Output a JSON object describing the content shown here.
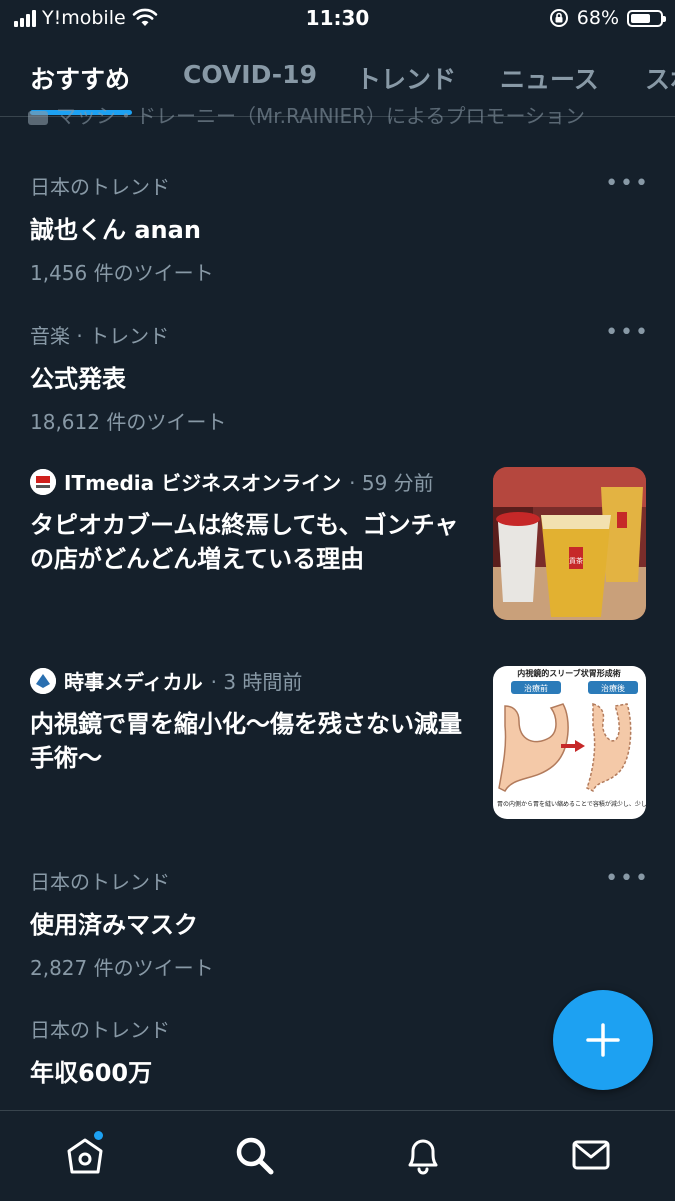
{
  "status_bar": {
    "carrier": "Y!mobile",
    "time": "11:30",
    "battery_percent": "68%",
    "battery_level": 0.68
  },
  "tabs": [
    {
      "label": "おすすめ",
      "active": true
    },
    {
      "label": "COVID-19",
      "active": false
    },
    {
      "label": "トレンド",
      "active": false
    },
    {
      "label": "ニュース",
      "active": false
    },
    {
      "label": "スポ",
      "active": false
    }
  ],
  "peek_text": "マッシ・ドレーニー（Mr.RAINIER）によるプロモーション",
  "items": [
    {
      "type": "trend",
      "context": "日本のトレンド",
      "title": "誠也くん anan",
      "count": "1,456 件のツイート"
    },
    {
      "type": "trend",
      "context": "音楽 · トレンド",
      "title": "公式発表",
      "count": "18,612 件のツイート"
    },
    {
      "type": "news",
      "source": "ITmedia ビジネスオンライン",
      "time": "· 59 分前",
      "headline": "タピオカブームは終焉しても、ゴンチャの店がどんどん増えている理由"
    },
    {
      "type": "news",
      "source": "時事メディカル",
      "time": "· 3 時間前",
      "headline": "内視鏡で胃を縮小化〜傷を残さない減量手術〜"
    },
    {
      "type": "trend",
      "context": "日本のトレンド",
      "title": "使用済みマスク",
      "count": "2,827 件のツイート"
    },
    {
      "type": "trend",
      "context": "日本のトレンド",
      "title": "年収600万",
      "count": ""
    }
  ],
  "thumb_text": {
    "itmedia_logo": "ITmedia ビジネス",
    "gong_cha": "貢茶",
    "stomach_title": "内視鏡的スリーブ状胃形成術",
    "stomach_before": "治療前",
    "stomach_after": "治療後",
    "stomach_caption": "胃の内側から胃を縫い縮めることで容積が減少し、少しの食事量で満腹感が得られる"
  },
  "more_glyph": "•••",
  "icons": {
    "home": "home-icon",
    "search": "search-icon",
    "notifications": "bell-icon",
    "messages": "mail-icon",
    "compose": "plus-icon"
  },
  "colors": {
    "background": "#15202b",
    "accent": "#1da1f2",
    "secondary_text": "#8899a6",
    "divider": "#38444d"
  }
}
